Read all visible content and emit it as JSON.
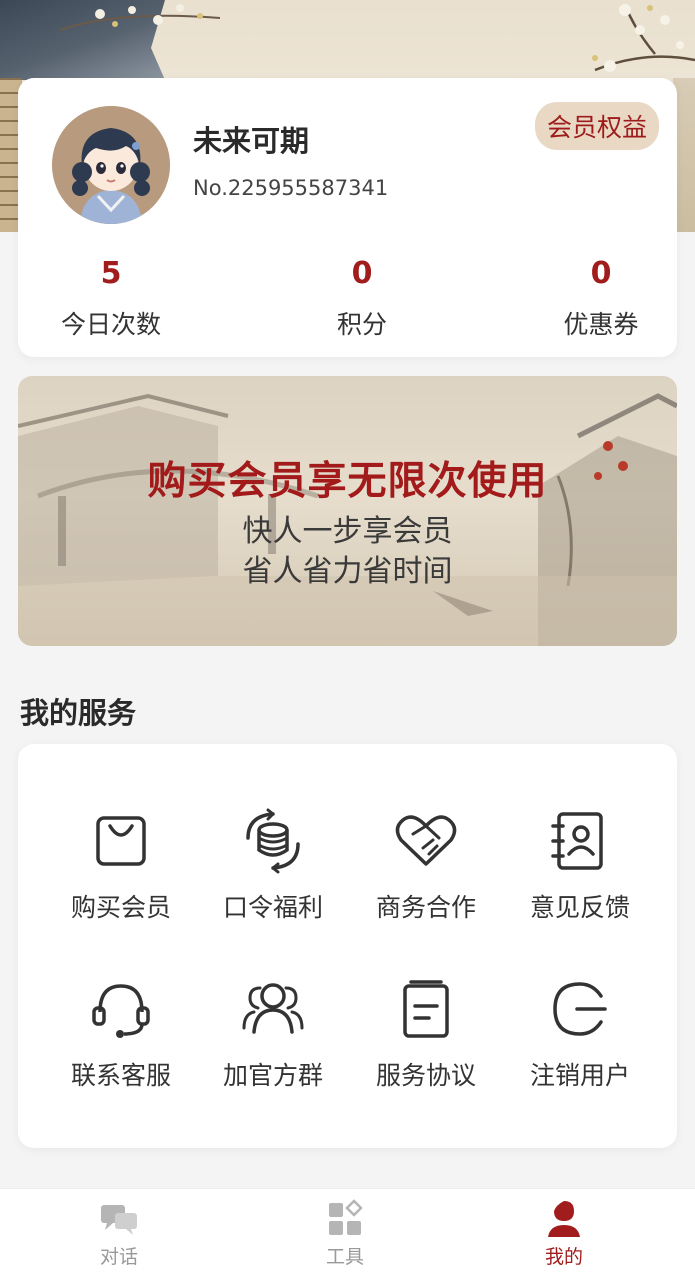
{
  "profile": {
    "name": "未来可期",
    "number": "No.225955587341",
    "vip_badge": "会员权益",
    "stats": [
      {
        "value": "5",
        "label": "今日次数"
      },
      {
        "value": "0",
        "label": "积分"
      },
      {
        "value": "0",
        "label": "优惠券"
      }
    ]
  },
  "banner": {
    "title": "购买会员享无限次使用",
    "line1": "快人一步享会员",
    "line2": "省人省力省时间"
  },
  "services": {
    "title": "我的服务",
    "items": [
      {
        "label": "购买会员",
        "icon": "shopping-bag-icon"
      },
      {
        "label": "口令福利",
        "icon": "coin-stack-icon"
      },
      {
        "label": "商务合作",
        "icon": "handshake-heart-icon"
      },
      {
        "label": "意见反馈",
        "icon": "contact-book-icon"
      },
      {
        "label": "联系客服",
        "icon": "headset-icon"
      },
      {
        "label": "加官方群",
        "icon": "group-icon"
      },
      {
        "label": "服务协议",
        "icon": "document-icon"
      },
      {
        "label": "注销用户",
        "icon": "logout-icon"
      }
    ]
  },
  "tabbar": {
    "items": [
      {
        "label": "对话",
        "icon": "chat-icon",
        "active": false
      },
      {
        "label": "工具",
        "icon": "tools-icon",
        "active": false
      },
      {
        "label": "我的",
        "icon": "user-icon",
        "active": true
      }
    ]
  },
  "colors": {
    "accent": "#a11d1d",
    "badge_bg": "#e8d8c4",
    "inactive": "#999999"
  }
}
